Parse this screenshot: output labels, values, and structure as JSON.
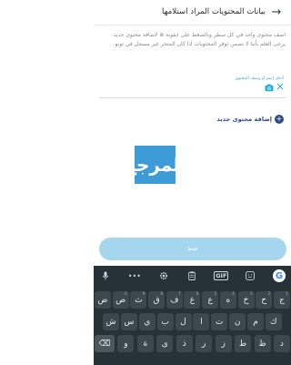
{
  "header": {
    "title": "بيانات المحتويات المراد استلامها",
    "back_icon": "arrow-right-icon"
  },
  "instructions": "اضف محتوى واحد في كل سطر وبالضغط على ايقونة ⊕ لاضافة محتوى جديد. يرجى العلم بأننا لا نضمن توفر المحتويات اذا كان المتجر غير مسجل في توبو.",
  "content_field": {
    "label": "أدخل إسم أو وصف المحتوى",
    "value": ""
  },
  "add_content": {
    "label": "إضافة محتوى جديد",
    "icon": "plus-circle-icon"
  },
  "logo": {
    "text": "المرجع",
    "color": "#3d9cd8"
  },
  "save_button": {
    "label": "حفظ",
    "color": "#a6d6ee"
  },
  "keyboard": {
    "toolbar": {
      "gif": "GIF",
      "dots": "•••",
      "google": "G"
    },
    "rows": [
      [
        {
          "label": "ج",
          "num": "1"
        },
        {
          "label": "ح",
          "num": "2"
        },
        {
          "label": "خ",
          "num": "3"
        },
        {
          "label": "ه",
          "num": "4"
        },
        {
          "label": "ع",
          "num": "5"
        },
        {
          "label": "غ",
          "num": "6"
        },
        {
          "label": "ف",
          "num": "7"
        },
        {
          "label": "ق",
          "num": "8"
        },
        {
          "label": "ث",
          "num": "9"
        },
        {
          "label": "ص",
          "num": "0"
        },
        {
          "label": "ض",
          "num": ""
        }
      ],
      [
        {
          "label": "ك",
          "num": ""
        },
        {
          "label": "م",
          "num": ""
        },
        {
          "label": "ن",
          "num": ""
        },
        {
          "label": "ت",
          "num": ""
        },
        {
          "label": "ا",
          "num": ""
        },
        {
          "label": "ل",
          "num": ""
        },
        {
          "label": "ب",
          "num": ""
        },
        {
          "label": "ي",
          "num": ""
        },
        {
          "label": "س",
          "num": ""
        },
        {
          "label": "ش",
          "num": ""
        }
      ],
      [
        {
          "label": "د",
          "num": ""
        },
        {
          "label": "ظ",
          "num": ""
        },
        {
          "label": "ط",
          "num": ""
        },
        {
          "label": "ز",
          "num": ""
        },
        {
          "label": "ر",
          "num": ""
        },
        {
          "label": "ذ",
          "num": ""
        },
        {
          "label": "ى",
          "num": ""
        },
        {
          "label": "ة",
          "num": ""
        },
        {
          "label": "و",
          "num": ""
        },
        {
          "label": "⌫",
          "num": ""
        }
      ]
    ],
    "bg": "#263238"
  }
}
